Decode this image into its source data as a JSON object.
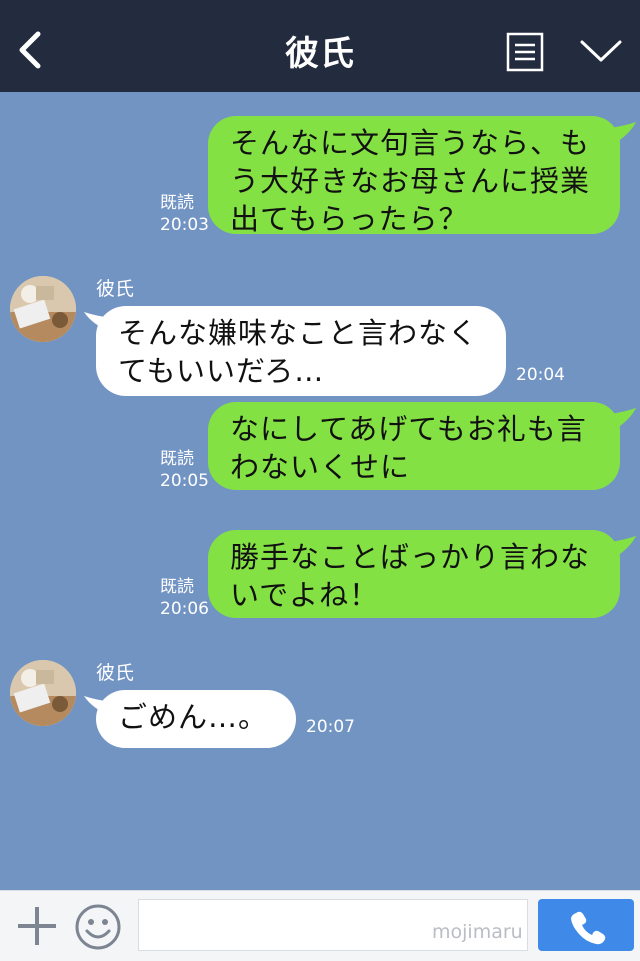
{
  "header": {
    "title": "彼氏",
    "back_icon": "chevron-left-icon",
    "menu_icon": "list-icon",
    "expand_icon": "chevron-down-icon",
    "background": "#232b3f"
  },
  "chat": {
    "background": "#7294c3",
    "sent_color": "#84e144",
    "received_color": "#ffffff",
    "messages": [
      {
        "direction": "sent",
        "text_lines": [
          "そんなに文句言うなら、も",
          "う大好きなお母さんに授業",
          "出てもらったら？"
        ],
        "read": "既読",
        "time": "20:03"
      },
      {
        "direction": "received",
        "sender": "彼氏",
        "text_lines": [
          "そんな嫌味なこと言わなく",
          "てもいいだろ…"
        ],
        "time": "20:04"
      },
      {
        "direction": "sent",
        "text_lines": [
          "なにしてあげてもお礼も言",
          "わないくせに"
        ],
        "read": "既読",
        "time": "20:05"
      },
      {
        "direction": "sent",
        "text_lines": [
          "勝手なことばっかり言わな",
          "いでよね！"
        ],
        "read": "既読",
        "time": "20:06"
      },
      {
        "direction": "received",
        "sender": "彼氏",
        "text_lines": [
          "ごめん…。"
        ],
        "time": "20:07"
      }
    ]
  },
  "input_bar": {
    "plus_icon": "plus-icon",
    "emoji_icon": "smile-icon",
    "input_value": "",
    "watermark": "mojimaru",
    "call_icon": "phone-icon",
    "call_color": "#3f8ae8"
  }
}
